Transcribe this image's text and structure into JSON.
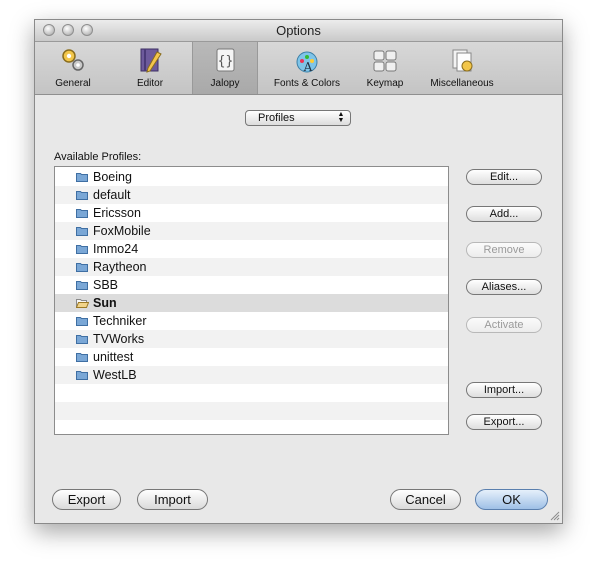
{
  "window": {
    "title": "Options"
  },
  "toolbar": {
    "items": [
      {
        "label": "General",
        "icon": "gears-icon"
      },
      {
        "label": "Editor",
        "icon": "pencil-notebook-icon"
      },
      {
        "label": "Jalopy",
        "icon": "braces-document-icon"
      },
      {
        "label": "Fonts & Colors",
        "icon": "font-palette-icon"
      },
      {
        "label": "Keymap",
        "icon": "keyboard-icon"
      },
      {
        "label": "Miscellaneous",
        "icon": "misc-documents-icon"
      }
    ],
    "selected": "Jalopy"
  },
  "profiles_popup": {
    "value": "Profiles"
  },
  "available_profiles": {
    "label": "Available Profiles:",
    "items": [
      "Boeing",
      "default",
      "Ericsson",
      "FoxMobile",
      "Immo24",
      "Raytheon",
      "SBB",
      "Sun",
      "Techniker",
      "TVWorks",
      "unittest",
      "WestLB"
    ],
    "selected": "Sun"
  },
  "side_buttons": {
    "edit": "Edit...",
    "add": "Add...",
    "remove": "Remove",
    "aliases": "Aliases...",
    "activate": "Activate",
    "import": "Import...",
    "export": "Export..."
  },
  "bottom": {
    "export": "Export",
    "import": "Import",
    "cancel": "Cancel",
    "ok": "OK"
  },
  "colors": {
    "window_bg": "#e8e8e8",
    "folder_blue": "#7aa7d6",
    "default_button": "#9fc0e6"
  }
}
